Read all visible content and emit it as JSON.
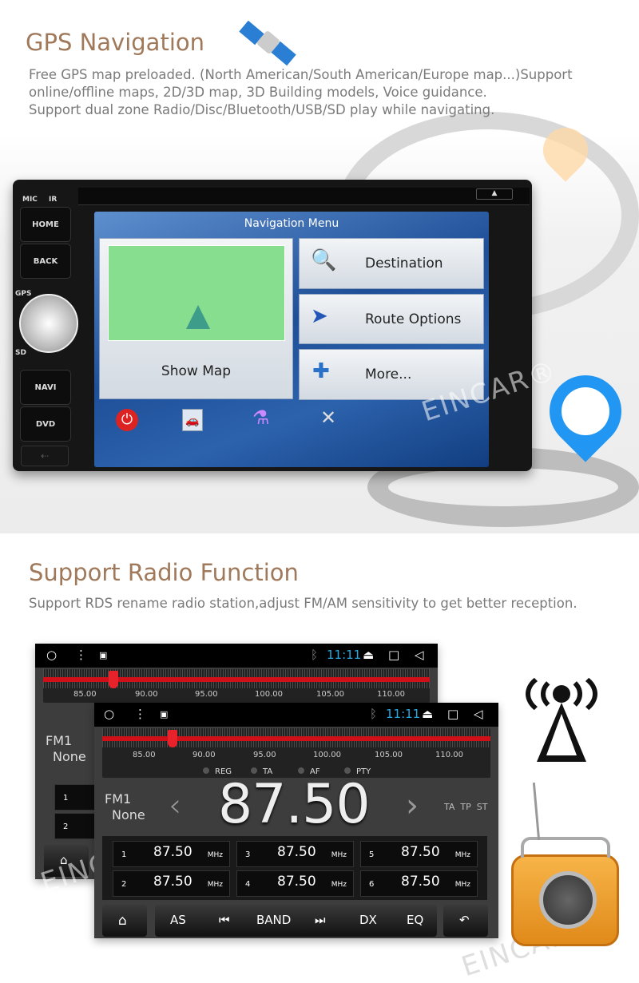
{
  "gps_section": {
    "title": "GPS Navigation",
    "description": [
      "Free GPS map preloaded. (North American/South American/Europe map...)Support",
      "online/offline maps, 2D/3D map, 3D Building models, Voice guidance.",
      "Support dual zone Radio/Disc/Bluetooth/USB/SD play while navigating."
    ],
    "unit": {
      "labels": {
        "mic": "MIC",
        "ir": "IR",
        "gps": "GPS",
        "sd": "SD"
      },
      "buttons": [
        "HOME",
        "BACK",
        "NAVI",
        "DVD"
      ],
      "screen": {
        "title": "Navigation Menu",
        "show_map": "Show Map",
        "menu_items": [
          {
            "label": "Destination",
            "icon": "magnifier-icon"
          },
          {
            "label": "Route Options",
            "icon": "route-icon"
          },
          {
            "label": "More...",
            "icon": "puzzle-icon"
          }
        ],
        "bottom_icons": [
          "power-icon",
          "traffic-icon",
          "flask-icon",
          "tools-icon"
        ]
      }
    },
    "watermark": "EINCAR®",
    "accent_color": "#2196f3"
  },
  "radio_section": {
    "title": "Support Radio Function",
    "description": "Support RDS rename radio station,adjust FM/AM sensitivity to get better reception.",
    "screen": {
      "time": "11:11",
      "scale": [
        "85.00",
        "90.00",
        "95.00",
        "100.00",
        "105.00",
        "110.00"
      ],
      "options": [
        "REG",
        "TA",
        "AF",
        "PTY"
      ],
      "band": "FM1",
      "station": "None",
      "frequency": "87.50",
      "flags": "TA  TP  ST",
      "unit": "MHz",
      "presets": [
        {
          "n": "1",
          "f": "87.50"
        },
        {
          "n": "2",
          "f": "87.50"
        },
        {
          "n": "3",
          "f": "87.50"
        },
        {
          "n": "4",
          "f": "87.50"
        },
        {
          "n": "5",
          "f": "87.50"
        },
        {
          "n": "6",
          "f": "87.50"
        }
      ],
      "controls": [
        "AS",
        "BAND",
        "DX",
        "EQ"
      ],
      "tuner_color": "#d01018",
      "time_color": "#29a8e0"
    },
    "watermark": "EINCAR®"
  }
}
